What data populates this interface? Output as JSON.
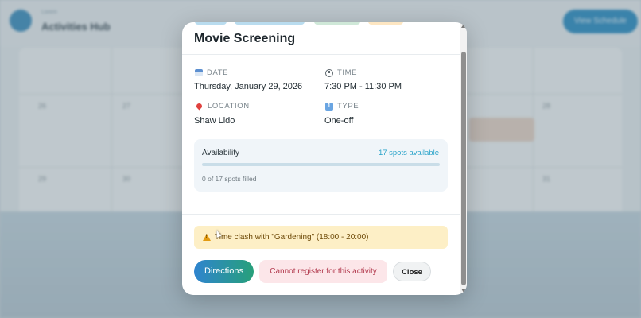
{
  "background": {
    "app_subtitle": "Lorem",
    "app_title": "Activities Hub",
    "header_button": "View Schedule",
    "day_numbers": [
      "26",
      "27",
      "28",
      "29",
      "30",
      "31"
    ]
  },
  "modal": {
    "title": "Movie Screening",
    "date": {
      "label": "DATE",
      "value": "Thursday, January 29, 2026",
      "icon": "calendar-icon"
    },
    "time": {
      "label": "TIME",
      "value": "7:30 PM - 11:30 PM",
      "icon": "clock-icon"
    },
    "location": {
      "label": "LOCATION",
      "value": "Shaw Lido",
      "icon": "map-pin-icon"
    },
    "type": {
      "label": "TYPE",
      "value": "One-off",
      "icon": "type-icon"
    },
    "availability": {
      "title": "Availability",
      "spots_available": "17 spots available",
      "filled_fraction": 0,
      "filled_text": "0 of 17 spots filled"
    },
    "warning": {
      "icon": "warning-icon",
      "text": "Time clash with \"Gardening\" (18:00 - 20:00)"
    },
    "buttons": {
      "directions": "Directions",
      "register_disabled": "Cannot register for this activity",
      "close": "Close"
    }
  },
  "colors": {
    "accent_blue": "#29a3c9",
    "warning_bg": "#fdefc6",
    "danger_text": "#b2394d"
  }
}
